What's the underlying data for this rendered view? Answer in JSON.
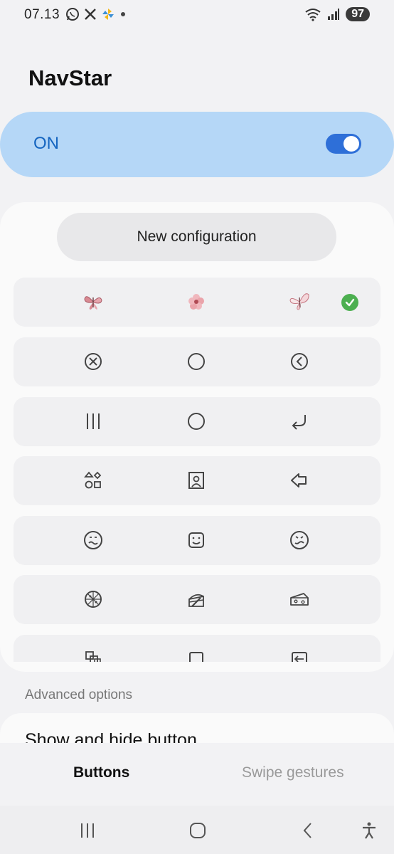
{
  "status": {
    "time": "07.13",
    "battery": "97",
    "icons_left": [
      "whatsapp-icon",
      "x-icon",
      "pinwheel-icon",
      "dot-icon"
    ],
    "icons_right": [
      "wifi-icon",
      "signal-icon",
      "battery-icon"
    ]
  },
  "app": {
    "title": "NavStar"
  },
  "master": {
    "label": "ON",
    "enabled": true
  },
  "panel": {
    "new_config_label": "New configuration",
    "configurations": [
      {
        "icons": [
          "butterfly-pink-icon",
          "flower-pink-icon",
          "butterfly-white-icon"
        ],
        "selected": true
      },
      {
        "icons": [
          "circle-x-icon",
          "circle-icon",
          "circle-back-icon"
        ],
        "selected": false
      },
      {
        "icons": [
          "three-lines-icon",
          "circle-icon",
          "return-arrow-icon"
        ],
        "selected": false
      },
      {
        "icons": [
          "apps-shapes-icon",
          "portrait-frame-icon",
          "arrow-left-outline-icon"
        ],
        "selected": false
      },
      {
        "icons": [
          "face-wavy-icon",
          "face-smile-icon",
          "face-wavy-alt-icon"
        ],
        "selected": false
      },
      {
        "icons": [
          "pizza-icon",
          "cake-icon",
          "cheese-icon"
        ],
        "selected": false
      },
      {
        "icons": [
          "windows-stack-icon",
          "square-icon",
          "enter-icon"
        ],
        "selected": false
      }
    ]
  },
  "advanced": {
    "section_label": "Advanced options",
    "show_hide_label": "Show and hide button"
  },
  "tabs": {
    "buttons_label": "Buttons",
    "swipe_label": "Swipe gestures",
    "active": "Buttons"
  },
  "navbar": {
    "icons": [
      "recents-icon",
      "home-icon",
      "back-icon",
      "accessibility-icon"
    ]
  },
  "colors": {
    "accent": "#2e6fd8",
    "on_card": "#b5d7f7",
    "on_text": "#1565c0",
    "check": "#4caf50"
  }
}
